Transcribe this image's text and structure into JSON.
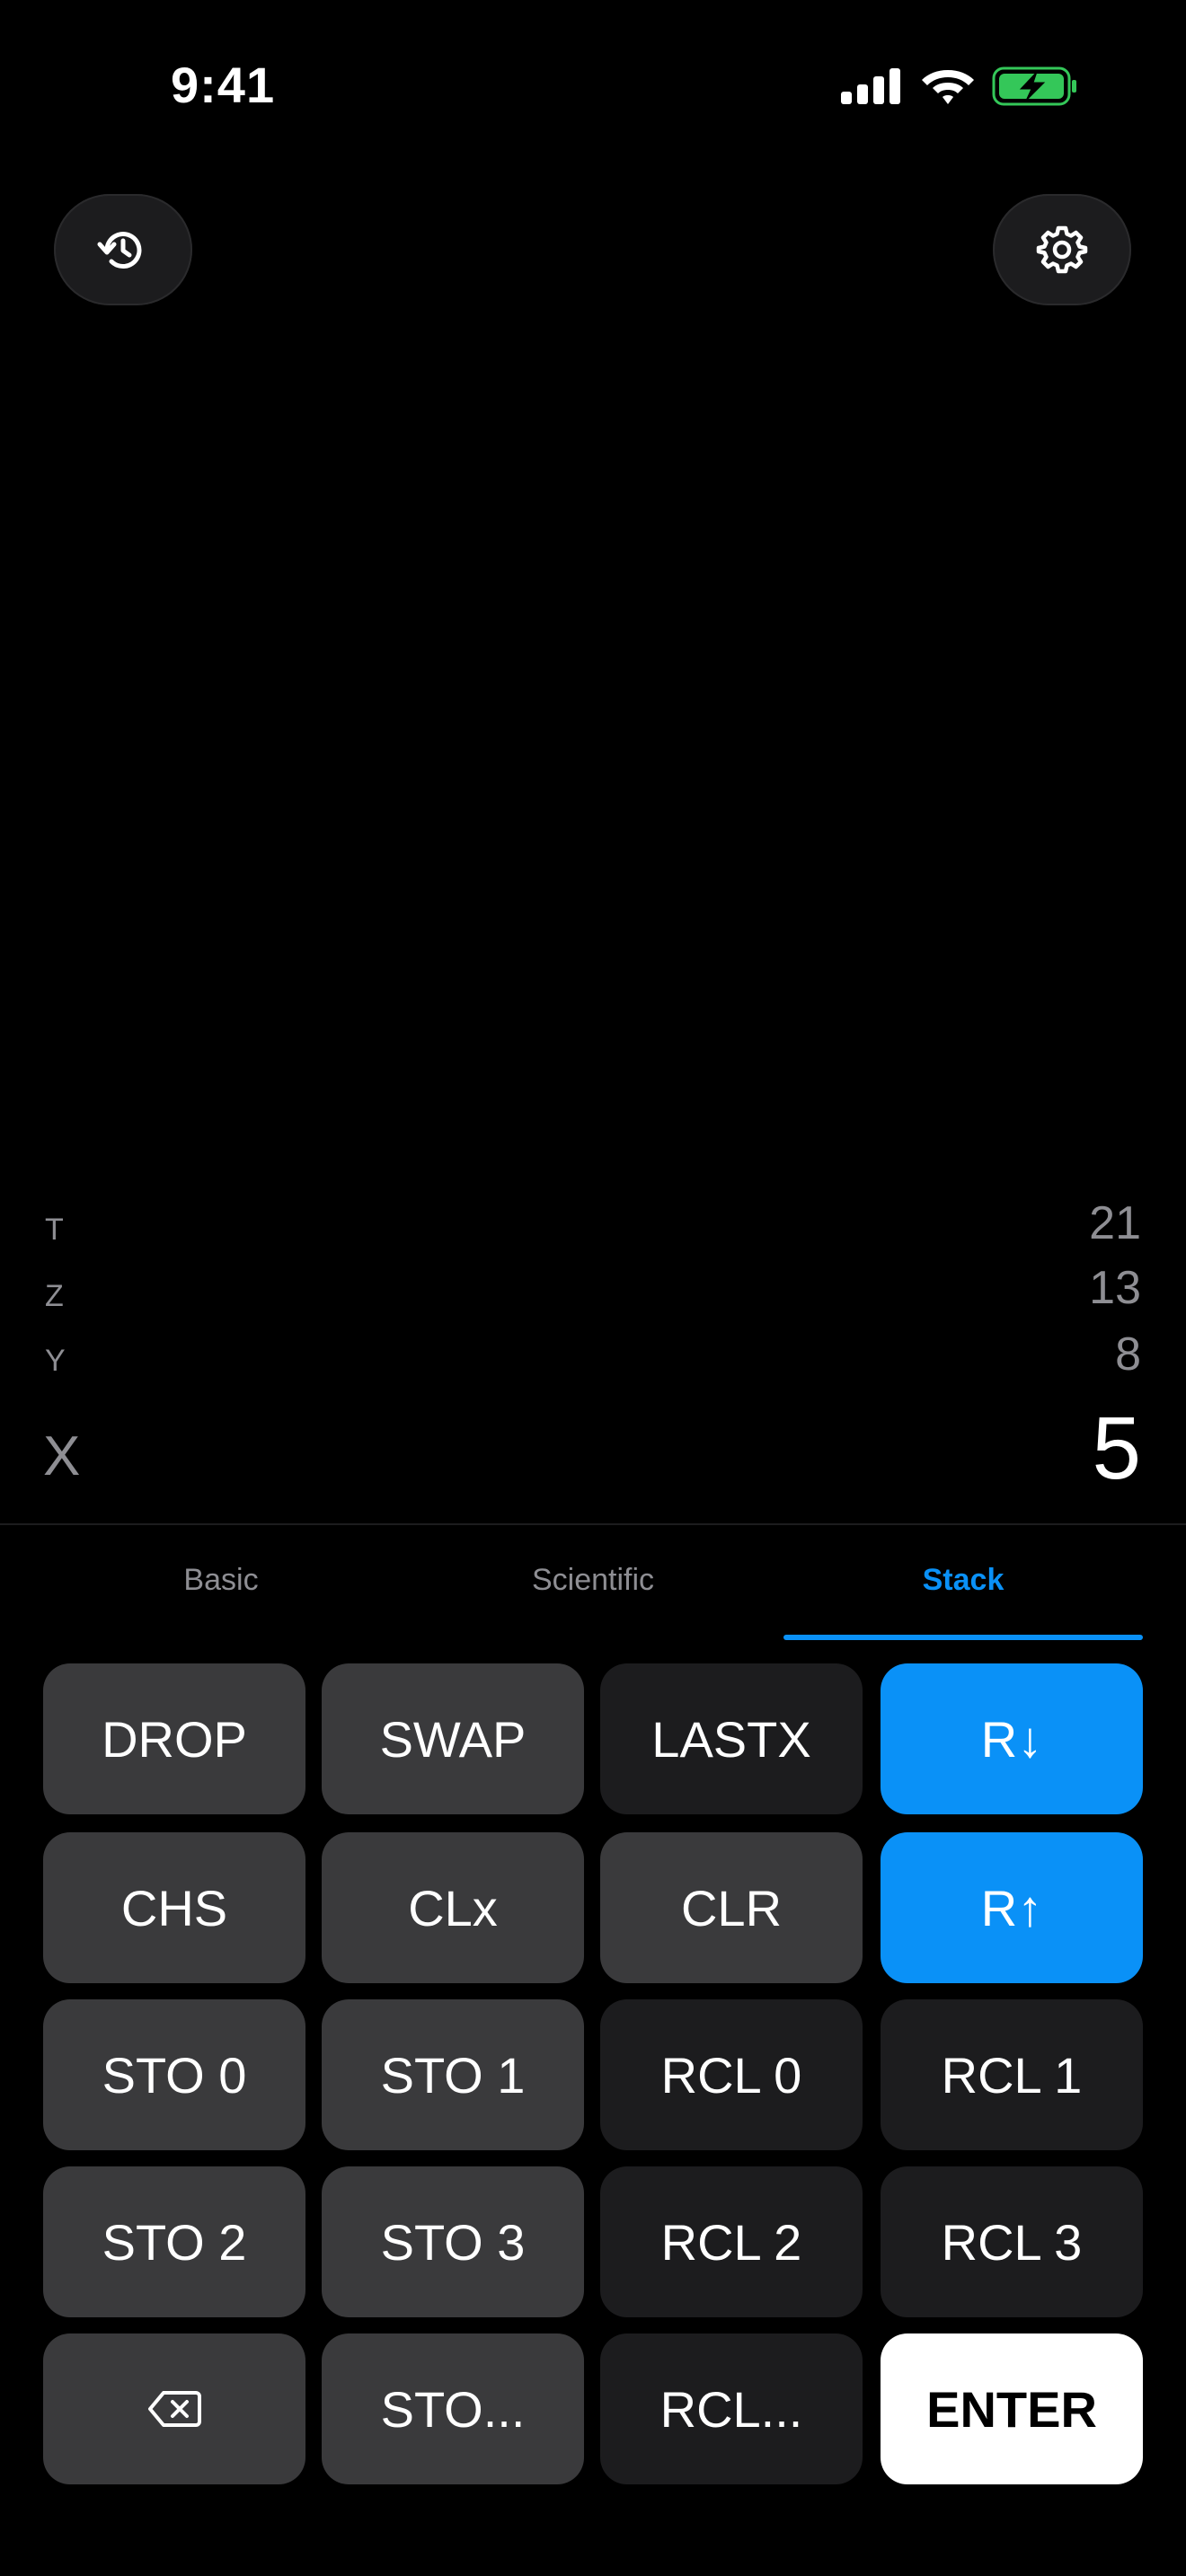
{
  "status_bar": {
    "time": "9:41",
    "signal_icon": "cellular-signal-icon",
    "wifi_icon": "wifi-icon",
    "battery_icon": "battery-charging-icon",
    "battery_color": "#34c759"
  },
  "toolbar": {
    "history_icon": "history-icon",
    "settings_icon": "gear-icon"
  },
  "stack": {
    "t_label": "T",
    "t_value": "21",
    "z_label": "Z",
    "z_value": "13",
    "y_label": "Y",
    "y_value": "8",
    "x_label": "X",
    "x_value": "5"
  },
  "tabs": [
    {
      "label": "Basic",
      "active": false
    },
    {
      "label": "Scientific",
      "active": false
    },
    {
      "label": "Stack",
      "active": true
    }
  ],
  "keypad": {
    "row0": [
      "DROP",
      "SWAP",
      "LASTX",
      "R↓"
    ],
    "row1": [
      "CHS",
      "CLx",
      "CLR",
      "R↑"
    ],
    "row2": [
      "STO 0",
      "STO 1",
      "RCL 0",
      "RCL 1"
    ],
    "row3": [
      "STO 2",
      "STO 3",
      "RCL 2",
      "RCL 3"
    ],
    "row4": [
      "backspace",
      "STO...",
      "RCL...",
      "ENTER"
    ],
    "backspace_icon": "backspace-icon"
  },
  "colors": {
    "accent": "#0a91f7",
    "key_light": "#3a3a3c",
    "key_dark": "#1c1c1e",
    "enter": "#ffffff"
  }
}
